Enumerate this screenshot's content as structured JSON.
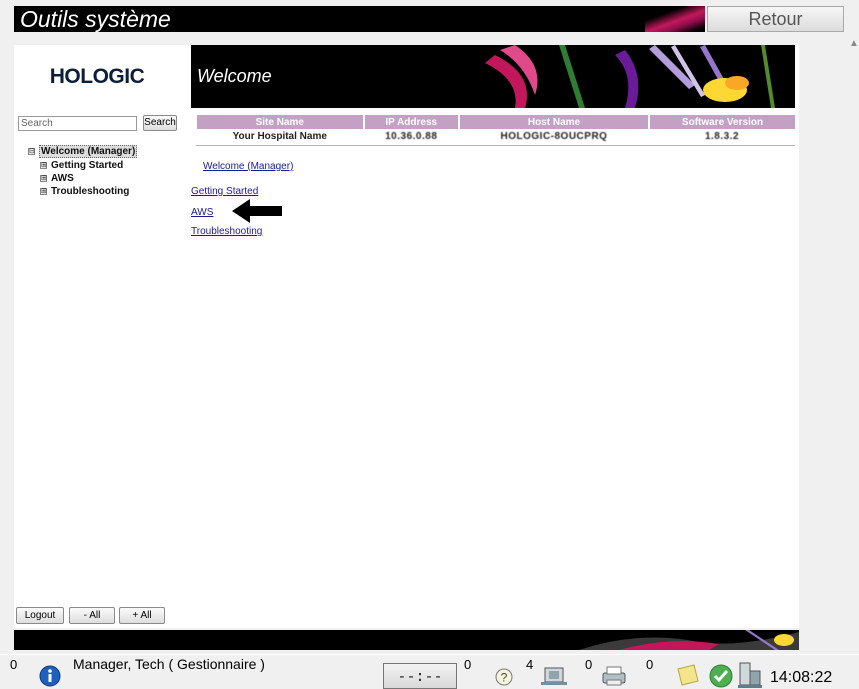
{
  "window": {
    "title": "Outils système",
    "back_button": "Retour"
  },
  "sidebar": {
    "logo": "HOLOGIC",
    "search": {
      "value": "Search",
      "button": "Search"
    },
    "tree": [
      {
        "label": "Welcome (Manager)",
        "expander": "⊟"
      },
      {
        "label": "Getting Started",
        "expander": "⊞"
      },
      {
        "label": "AWS",
        "expander": "⊞"
      },
      {
        "label": "Troubleshooting",
        "expander": "⊞"
      }
    ],
    "buttons": {
      "logout": "Logout",
      "collapse_all": "- All",
      "expand_all": "+ All"
    }
  },
  "main": {
    "banner_title": "Welcome",
    "table": {
      "headers": [
        "Site Name",
        "IP Address",
        "Host Name",
        "Software Version"
      ],
      "row": [
        "Your Hospital Name",
        "10.36.0.88",
        "HOLOGIC-8OUCPRQ",
        "1.8.3.2"
      ]
    },
    "links": {
      "welcome": "Welcome (Manager)",
      "getting_started": "Getting Started",
      "aws": "AWS",
      "troubleshooting": "Troubleshooting"
    }
  },
  "taskbar": {
    "left_count": "0",
    "user": "Manager, Tech ( Gestionnaire )",
    "timer": "--:--",
    "counts": [
      "0",
      "4",
      "0",
      "0"
    ],
    "clock": "14:08:22"
  },
  "icons": {
    "info": "info-icon",
    "help": "question-icon",
    "media": "media-icon",
    "printer": "printer-icon",
    "note": "note-icon",
    "status": "checkmark-icon",
    "system": "system-icon",
    "arrow": "arrow-left-icon"
  },
  "colors": {
    "header_row": "#c4a0c4",
    "accent": "#c2185b",
    "banner_bg": "#000000"
  }
}
